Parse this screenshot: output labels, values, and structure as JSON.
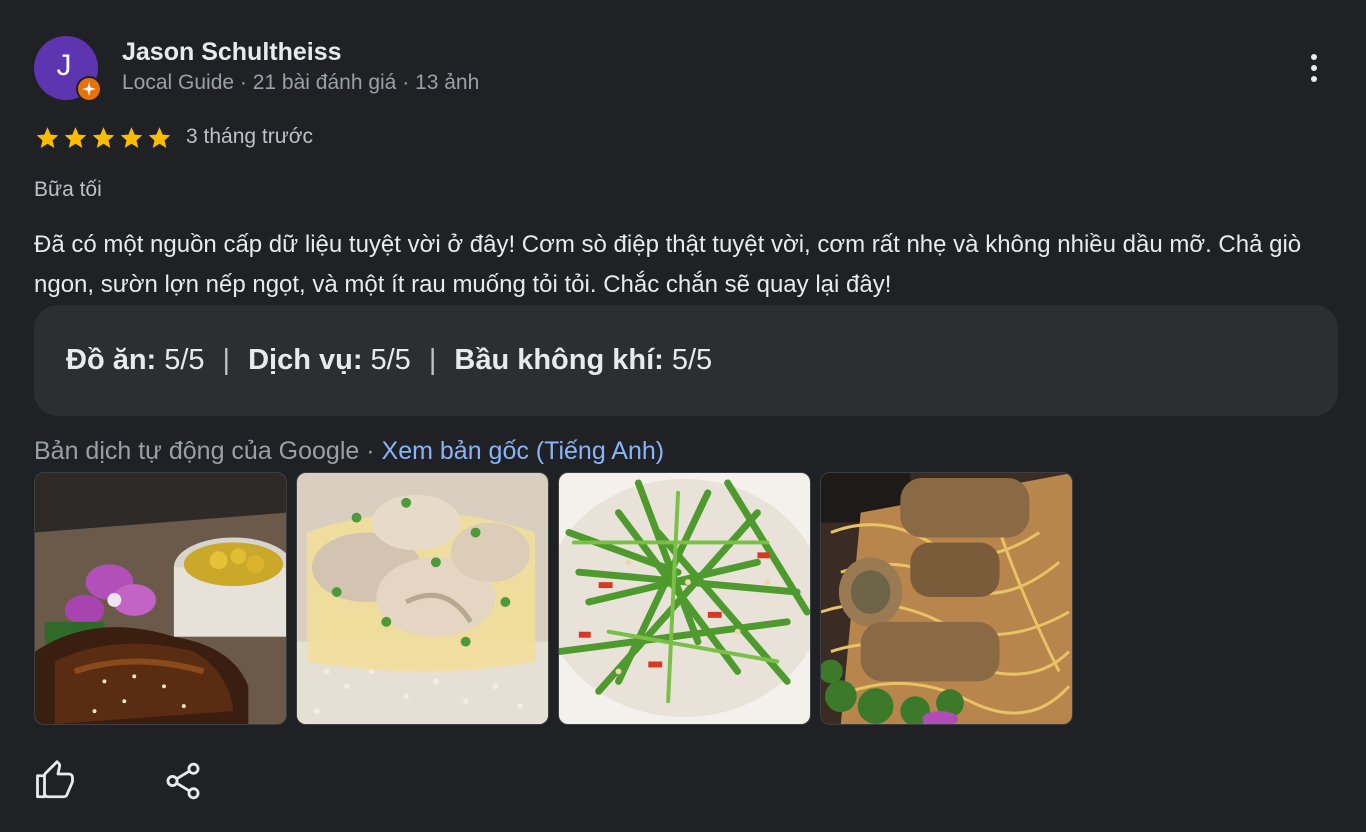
{
  "author": {
    "initial": "J",
    "name": "Jason Schultheiss",
    "meta": "Local Guide · 21 bài đánh giá · 13 ảnh",
    "avatar_color": "#5e35b1",
    "badge_color": "#e8710a"
  },
  "rating": {
    "stars": 5,
    "time": "3 tháng trước",
    "star_color": "#fbbc04"
  },
  "meal_type": "Bữa tối",
  "text": "Đã có một nguồn cấp dữ liệu tuyệt vời ở đây! Cơm sò điệp thật tuyệt vời, cơm rất nhẹ và không nhiều dầu mỡ. Chả giò ngon, sườn lợn nếp ngọt, và một ít rau muống tỏi tỏi. Chắc chắn sẽ quay lại đây!",
  "subratings": [
    {
      "label": "Đồ ăn:",
      "value": "5/5"
    },
    {
      "label": "Dịch vụ:",
      "value": "5/5"
    },
    {
      "label": "Bầu không khí:",
      "value": "5/5"
    }
  ],
  "subrating_separator": "|",
  "translation": {
    "note": "Bản dịch tự động của Google",
    "separator": "·",
    "link": "Xem bản gốc (Tiếng Anh)"
  },
  "photos": [
    {
      "icon": "ribs-photo"
    },
    {
      "icon": "scallop-rice-photo"
    },
    {
      "icon": "morning-glory-photo"
    },
    {
      "icon": "spring-rolls-photo"
    }
  ],
  "actions": {
    "like_icon": "thumb-up-icon",
    "share_icon": "share-icon"
  },
  "colors": {
    "background": "#202124",
    "link": "#8ab4f8",
    "muted": "#9aa0a6"
  }
}
